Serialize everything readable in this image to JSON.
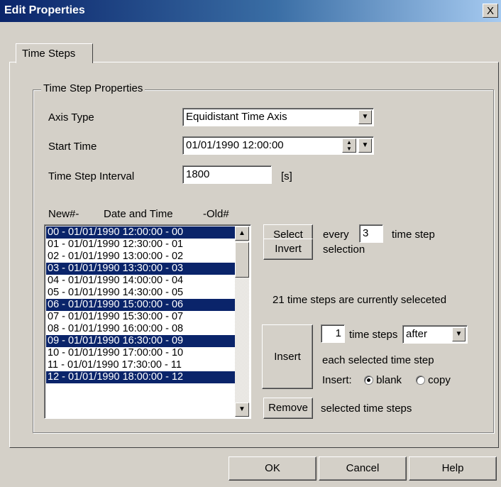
{
  "window": {
    "title": "Edit Properties",
    "close_glyph": "X"
  },
  "tabs": [
    {
      "label": "Time Steps"
    }
  ],
  "group": {
    "legend": "Time Step Properties"
  },
  "axis_type": {
    "label": "Axis Type",
    "value": "Equidistant Time Axis"
  },
  "start_time": {
    "label": "Start Time",
    "value": "01/01/1990 12:00:00"
  },
  "interval": {
    "label": "Time Step Interval",
    "value": "1800",
    "unit": "[s]"
  },
  "list": {
    "header_new": "New#-",
    "header_date": "Date and Time",
    "header_old": "-Old#",
    "rows": [
      {
        "text": "00 - 01/01/1990 12:00:00 - 00",
        "selected": true
      },
      {
        "text": "01 - 01/01/1990 12:30:00 - 01",
        "selected": false
      },
      {
        "text": "02 - 01/01/1990 13:00:00 - 02",
        "selected": false
      },
      {
        "text": "03 - 01/01/1990 13:30:00 - 03",
        "selected": true
      },
      {
        "text": "04 - 01/01/1990 14:00:00 - 04",
        "selected": false
      },
      {
        "text": "05 - 01/01/1990 14:30:00 - 05",
        "selected": false
      },
      {
        "text": "06 - 01/01/1990 15:00:00 - 06",
        "selected": true
      },
      {
        "text": "07 - 01/01/1990 15:30:00 - 07",
        "selected": false
      },
      {
        "text": "08 - 01/01/1990 16:00:00 - 08",
        "selected": false
      },
      {
        "text": "09 - 01/01/1990 16:30:00 - 09",
        "selected": true
      },
      {
        "text": "10 - 01/01/1990 17:00:00 - 10",
        "selected": false
      },
      {
        "text": "11 - 01/01/1990 17:30:00 - 11",
        "selected": false
      },
      {
        "text": "12 - 01/01/1990 18:00:00 - 12",
        "selected": true
      }
    ]
  },
  "select": {
    "button": "Select",
    "every": "every",
    "n": "3",
    "suffix": "time step"
  },
  "invert": {
    "button": "Invert",
    "suffix": "selection"
  },
  "status": {
    "text": "21 time steps are currently seleceted"
  },
  "insert": {
    "button": "Insert",
    "count": "1",
    "steps_label": "time steps",
    "position": "after",
    "each_label": "each selected time step",
    "mode_label": "Insert:",
    "options": [
      {
        "label": "blank",
        "checked": true
      },
      {
        "label": "copy",
        "checked": false
      }
    ]
  },
  "remove": {
    "button": "Remove",
    "suffix": "selected time steps"
  },
  "footer": {
    "ok": "OK",
    "cancel": "Cancel",
    "help": "Help"
  },
  "colors": {
    "selection": "#0a246a",
    "dialog": "#d4d0c8",
    "title_start": "#0a246a",
    "title_end": "#a6caf0"
  }
}
